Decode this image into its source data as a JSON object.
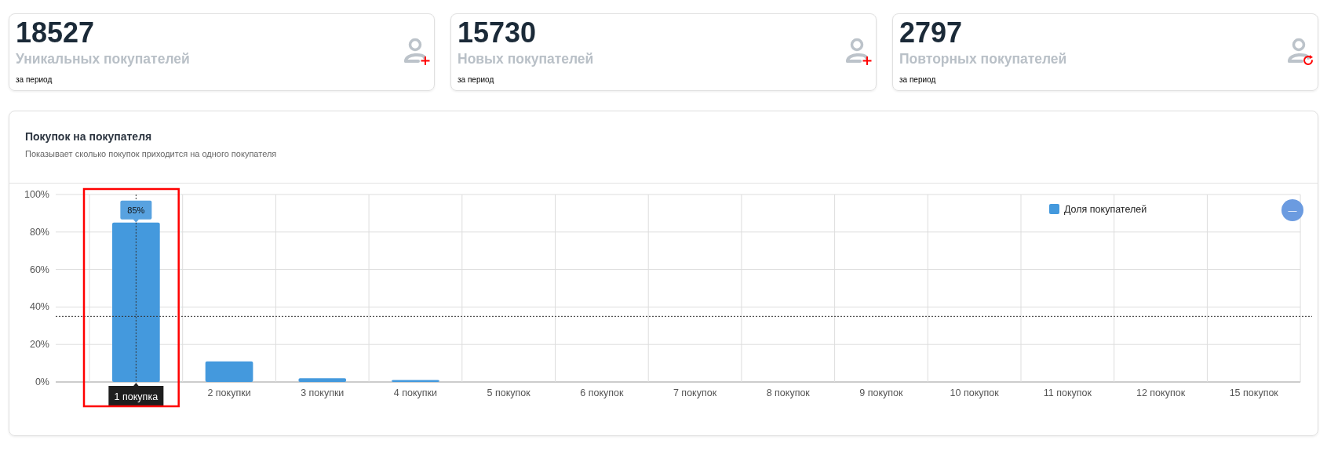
{
  "cards": [
    {
      "value": "18527",
      "label": "Уникальных покупателей",
      "period": "за период",
      "kind": "plus"
    },
    {
      "value": "15730",
      "label": "Новых покупателей",
      "period": "за период",
      "kind": "plus"
    },
    {
      "value": "2797",
      "label": "Повторных покупателей",
      "period": "за период",
      "kind": "refresh"
    }
  ],
  "chart_panel": {
    "title": "Покупок на покупателя",
    "subtitle": "Показывает сколько покупок приходится на одного покупателя",
    "collapse_button": "—",
    "tooltip": {
      "value": "85%"
    },
    "chart_data": {
      "type": "bar",
      "categories": [
        "1 покупка",
        "2 покупки",
        "3 покупки",
        "4 покупки",
        "5 покупок",
        "6 покупок",
        "7 покупок",
        "8 покупок",
        "9 покупок",
        "10 покупок",
        "11 покупок",
        "12 покупок",
        "15 покупок"
      ],
      "series": [
        {
          "name": "Доля покупателей",
          "color": "#4499dd",
          "values": [
            85,
            11,
            2,
            1,
            0,
            0,
            0,
            0,
            0,
            0,
            0,
            0,
            0
          ]
        }
      ],
      "ylim": [
        0,
        100
      ],
      "grid": true,
      "yticks": [
        {
          "value": 0,
          "label": "0%"
        },
        {
          "value": 20,
          "label": "20%"
        },
        {
          "value": 40,
          "label": "40%"
        },
        {
          "value": 60,
          "label": "60%"
        },
        {
          "value": 80,
          "label": "80%"
        },
        {
          "value": 100,
          "label": "100%"
        }
      ]
    }
  }
}
